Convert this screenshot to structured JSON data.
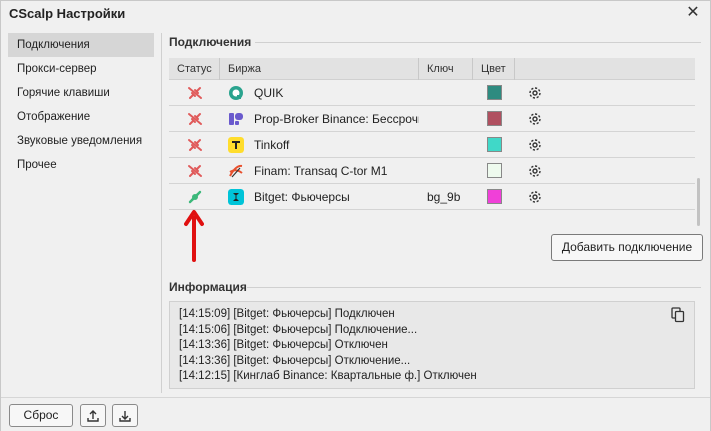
{
  "window": {
    "title": "CScalp Настройки",
    "close_glyph": "✕"
  },
  "sidebar": {
    "items": [
      {
        "label": "Подключения",
        "active": true
      },
      {
        "label": "Прокси-сервер"
      },
      {
        "label": "Горячие клавиши"
      },
      {
        "label": "Отображение"
      },
      {
        "label": "Звуковые уведомления"
      },
      {
        "label": "Прочее"
      }
    ]
  },
  "connections": {
    "section_title": "Подключения",
    "columns": {
      "status": "Статус",
      "exchange": "Биржа",
      "key": "Ключ",
      "color": "Цвет"
    },
    "rows": [
      {
        "status": "disconnected",
        "logo_icon": "quik-logo-icon",
        "exchange": "QUIK",
        "key": "",
        "color": "#2e8b80"
      },
      {
        "status": "disconnected",
        "logo_icon": "prop-broker-logo-icon",
        "exchange": "Prop-Broker Binance: Бессрочные",
        "key": "",
        "color": "#b05060"
      },
      {
        "status": "disconnected",
        "logo_icon": "tinkoff-logo-icon",
        "exchange": "Tinkoff",
        "key": "",
        "color": "#40d8c8"
      },
      {
        "status": "disconnected",
        "logo_icon": "finam-logo-icon",
        "exchange": "Finam: Transaq C-tor M1",
        "key": "",
        "color": "#eefaee"
      },
      {
        "status": "connected",
        "logo_icon": "bitget-logo-icon",
        "exchange": "Bitget: Фьючерсы",
        "key": "bg_9b",
        "color": "#f040d8"
      }
    ],
    "add_button": "Добавить подключение",
    "status_colors": {
      "disconnected": "#e05a5a",
      "connected": "#3cb87a"
    }
  },
  "info": {
    "section_title": "Информация",
    "lines": [
      "[14:15:09] [Bitget: Фьючерсы] Подключен",
      "[14:15:06] [Bitget: Фьючерсы] Подключение...",
      "[14:13:36] [Bitget: Фьючерсы] Отключен",
      "[14:13:36] [Bitget: Фьючерсы] Отключение...",
      "[14:12:15] [Кинглаб Binance: Квартальные ф.] Отключен"
    ]
  },
  "footer": {
    "reset_button": "Сброс",
    "upload_icon": "upload-icon",
    "download_icon": "download-icon"
  },
  "annotation": {
    "arrow_color": "#e01010"
  }
}
